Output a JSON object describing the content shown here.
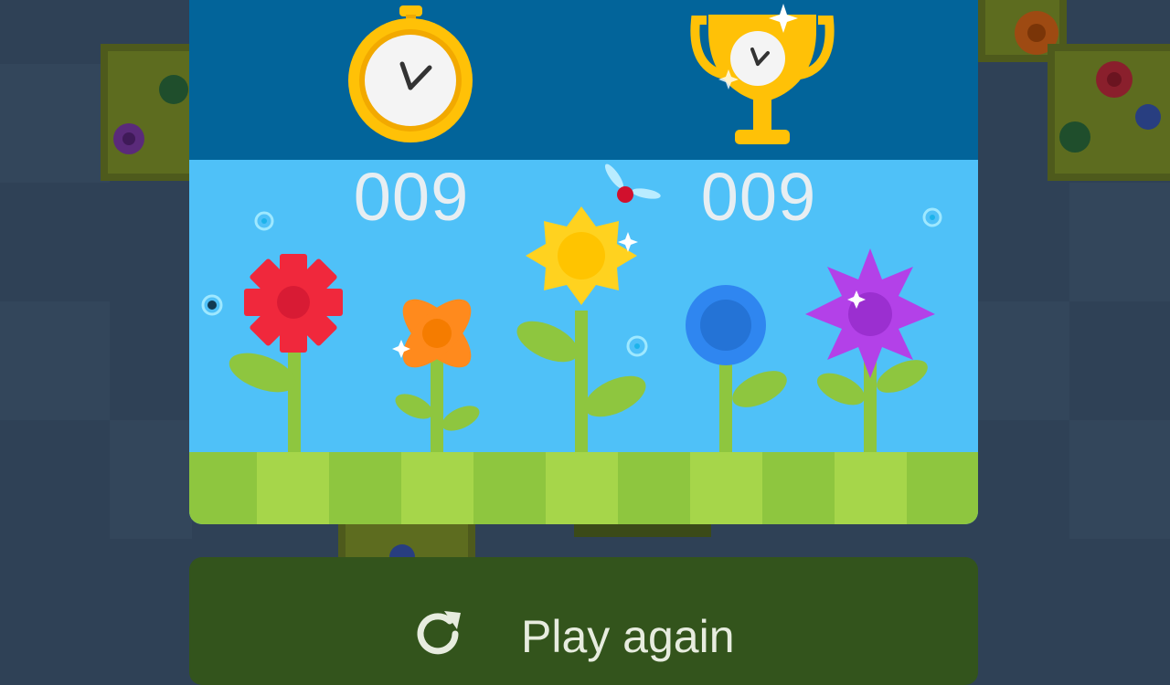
{
  "scores": {
    "time_value": "009",
    "best_value": "009"
  },
  "icons": {
    "timer": "stopwatch-icon",
    "best": "trophy-icon",
    "replay": "refresh-icon"
  },
  "colors": {
    "sky": "#4fc1f8",
    "header": "#02649a",
    "grass_light": "#a6d64a",
    "grass_dark": "#8ec63f",
    "button": "#33541c",
    "gold": "#ffc107"
  },
  "button": {
    "play_again_label": "Play again"
  }
}
